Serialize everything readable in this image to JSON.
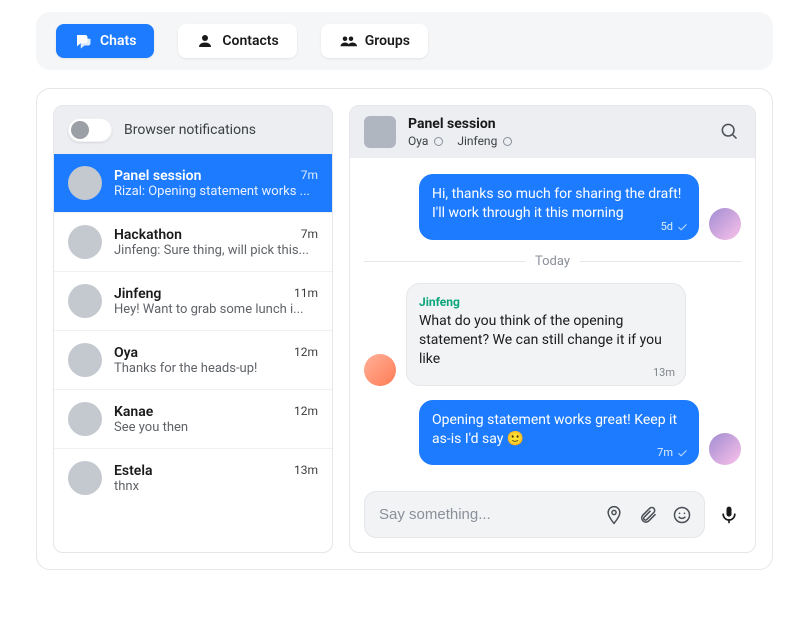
{
  "nav": {
    "tabs": [
      {
        "label": "Chats",
        "active": true
      },
      {
        "label": "Contacts",
        "active": false
      },
      {
        "label": "Groups",
        "active": false
      }
    ]
  },
  "sidebar": {
    "notifications_label": "Browser notifications",
    "items": [
      {
        "title": "Panel session",
        "time": "7m",
        "preview": "Rizal: Opening statement works ...",
        "active": true
      },
      {
        "title": "Hackathon",
        "time": "7m",
        "preview": "Jinfeng: Sure thing, will pick this...",
        "active": false
      },
      {
        "title": "Jinfeng",
        "time": "11m",
        "preview": "Hey! Want to grab some lunch i...",
        "active": false
      },
      {
        "title": "Oya",
        "time": "12m",
        "preview": "Thanks for the heads-up!",
        "active": false
      },
      {
        "title": "Kanae",
        "time": "12m",
        "preview": "See you then",
        "active": false
      },
      {
        "title": "Estela",
        "time": "13m",
        "preview": "thnx",
        "active": false
      }
    ]
  },
  "chat": {
    "title": "Panel session",
    "members": [
      "Oya",
      "Jinfeng"
    ],
    "day_separator": "Today",
    "messages": [
      {
        "from": "me",
        "text": "Hi, thanks so much for sharing the draft! I'll work through it this morning",
        "time": "5d"
      },
      {
        "from": "them",
        "sender": "Jinfeng",
        "text": "What do you think of the opening statement? We can still change it if you like",
        "time": "13m"
      },
      {
        "from": "me",
        "text": "Opening statement works great! Keep it as-is I'd say 🙂",
        "time": "7m"
      }
    ],
    "composer_placeholder": "Say something..."
  }
}
